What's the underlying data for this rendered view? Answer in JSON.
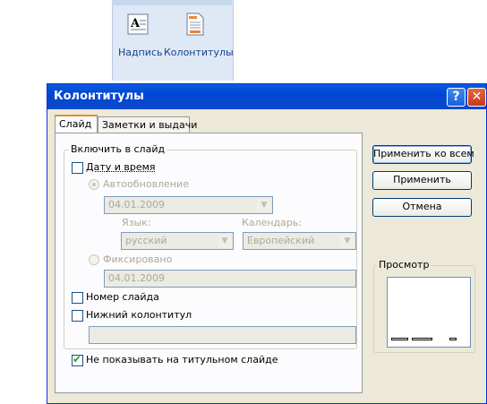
{
  "ribbon": {
    "insert_label_button": "Надпись",
    "headers_footers_button": "Колонтитулы"
  },
  "dialog": {
    "title": "Колонтитулы",
    "help_glyph": "?",
    "close_glyph": "✕",
    "tabs": [
      {
        "label": "Слайд",
        "active": true
      },
      {
        "label": "Заметки и выдачи",
        "active": false
      }
    ],
    "include_group": {
      "legend": "Включить в слайд",
      "date_time": {
        "label": "Дату и время",
        "checked": false
      },
      "auto_update": {
        "label": "Автообновление",
        "selected": true,
        "enabled": false
      },
      "auto_date_value": "04.01.2009",
      "language_label": "Язык:",
      "language_value": "русский",
      "calendar_label": "Календарь:",
      "calendar_value": "Европейский",
      "fixed": {
        "label": "Фиксировано",
        "selected": false,
        "enabled": false
      },
      "fixed_date_value": "04.01.2009",
      "slide_number": {
        "label": "Номер слайда",
        "checked": false
      },
      "footer": {
        "label": "Нижний колонтитул",
        "checked": false
      },
      "footer_value": ""
    },
    "dont_show_title": {
      "label": "Не показывать на титульном слайде",
      "checked": true
    },
    "buttons": {
      "apply_all": "Применить ко всем",
      "apply": "Применить",
      "cancel": "Отмена"
    },
    "preview_label": "Просмотр",
    "colors": {
      "title_bar": "#0a5bdc",
      "dialog_bg": "#ece9d8",
      "tab_accent": "#e68b2c"
    }
  }
}
